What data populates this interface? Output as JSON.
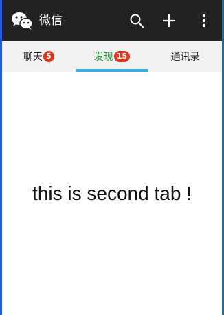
{
  "app_bar": {
    "title": "微信",
    "icons": {
      "logo": "wechat-logo-icon",
      "search": "search-icon",
      "add": "plus-icon",
      "more": "more-vertical-icon"
    },
    "colors": {
      "background": "#222222",
      "foreground": "#ffffff"
    }
  },
  "tabs": [
    {
      "label": "聊天",
      "badge": "5",
      "active": false
    },
    {
      "label": "发现",
      "badge": "15",
      "active": true
    },
    {
      "label": "通讯录",
      "active": false
    }
  ],
  "tab_colors": {
    "active_text": "#2ea043",
    "indicator": "#35b1df",
    "badge": "#d9361f"
  },
  "content": {
    "message": "this is second tab !"
  }
}
